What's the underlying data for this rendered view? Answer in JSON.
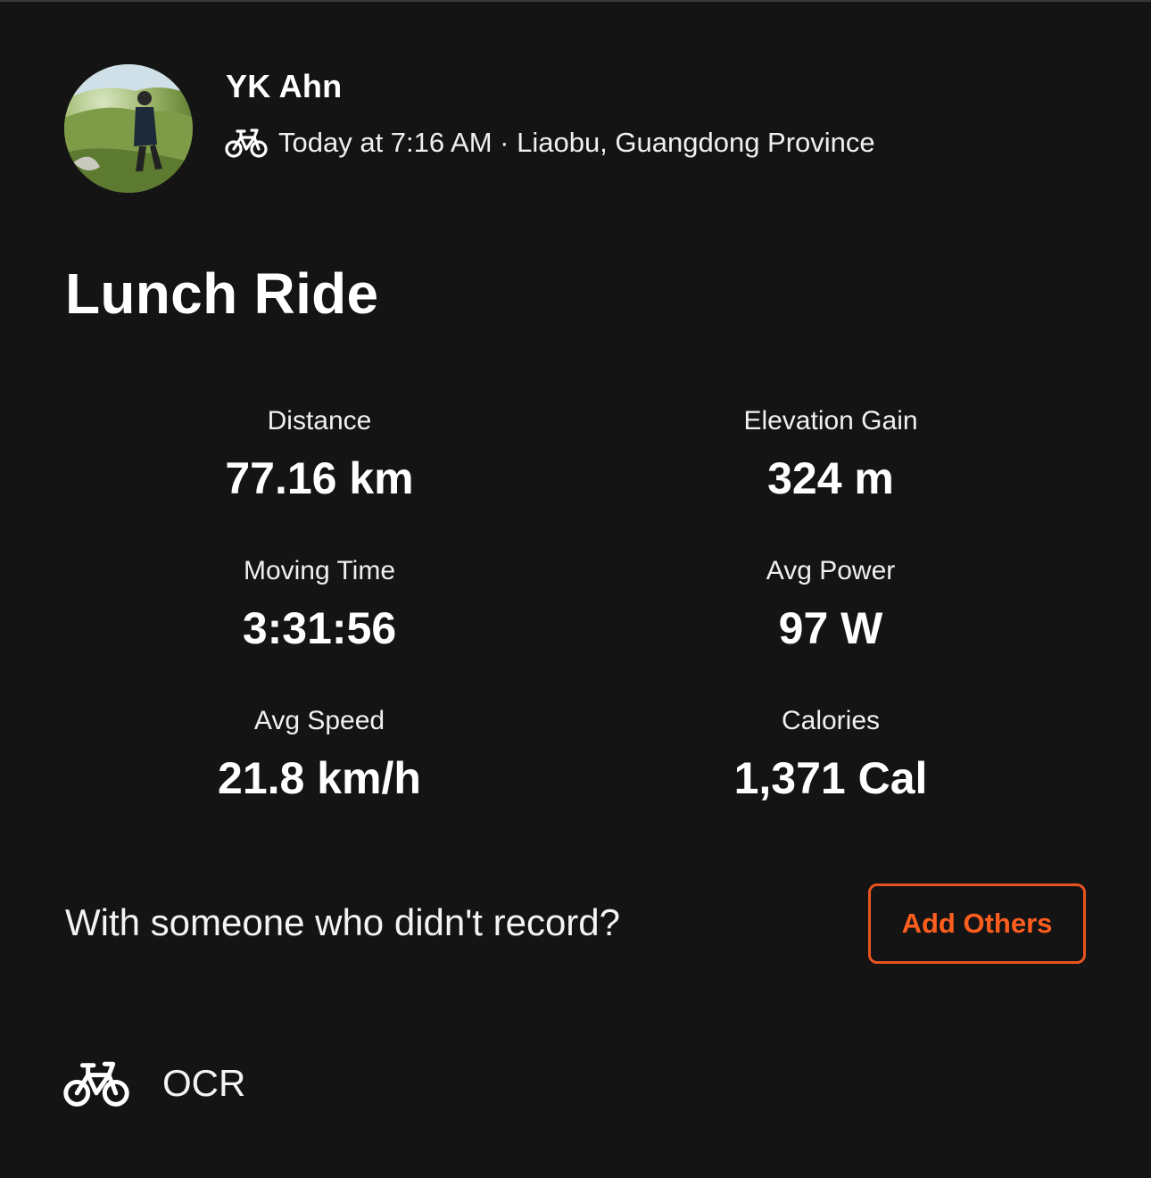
{
  "athlete": {
    "name": "YK Ahn",
    "avatar_icon": "person-hiking-photo"
  },
  "activity_meta": {
    "sport_icon": "bicycle-icon",
    "text": "Today at 7:16 AM · Liaobu, Guangdong Province"
  },
  "activity": {
    "title": "Lunch Ride"
  },
  "stats": {
    "distance": {
      "label": "Distance",
      "value": "77.16 km"
    },
    "elevation_gain": {
      "label": "Elevation Gain",
      "value": "324 m"
    },
    "moving_time": {
      "label": "Moving Time",
      "value": "3:31:56"
    },
    "avg_power": {
      "label": "Avg Power",
      "value": "97 W"
    },
    "avg_speed": {
      "label": "Avg Speed",
      "value": "21.8 km/h"
    },
    "calories": {
      "label": "Calories",
      "value": "1,371 Cal"
    }
  },
  "add_others": {
    "prompt": "With someone who didn't record?",
    "button_label": "Add Others"
  },
  "gear": {
    "icon": "bicycle-icon",
    "name": "OCR"
  },
  "colors": {
    "background": "#141414",
    "accent": "#ff5e1f",
    "text": "#ffffff"
  }
}
